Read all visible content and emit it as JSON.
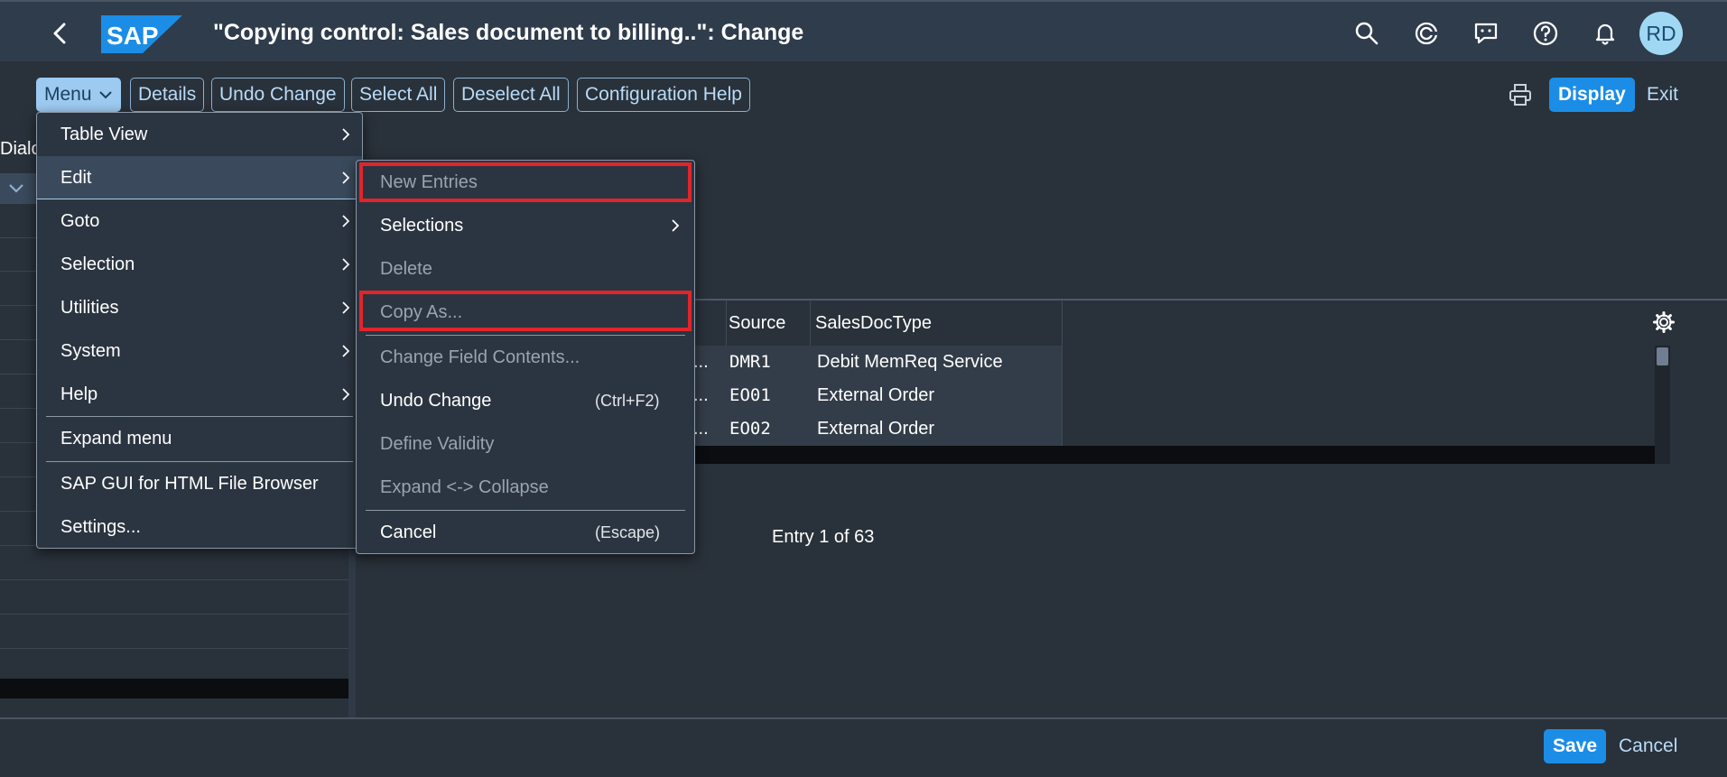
{
  "shell": {
    "logo_text": "SAP",
    "title": "\"Copying control: Sales document to billing..\": Change",
    "avatar_initials": "RD"
  },
  "toolbar": {
    "menu_label": "Menu",
    "details_label": "Details",
    "undo_change_label": "Undo Change",
    "select_all_label": "Select All",
    "deselect_all_label": "Deselect All",
    "config_help_label": "Configuration Help",
    "display_label": "Display",
    "exit_label": "Exit"
  },
  "left_panel": {
    "header": "Dialo"
  },
  "table": {
    "columns": [
      "Source",
      "SalesDocType"
    ],
    "rows": [
      {
        "prefix": "...",
        "source": "DMR1",
        "salesdoctype": "Debit MemReq Service"
      },
      {
        "prefix": "...",
        "source": "EO01",
        "salesdoctype": "External Order"
      },
      {
        "prefix": "...",
        "source": "EO02",
        "salesdoctype": "External Order"
      }
    ],
    "entry_info": "Entry 1 of 63"
  },
  "main_menu": {
    "items": [
      {
        "label": "Table View"
      },
      {
        "label": "Edit"
      },
      {
        "label": "Goto"
      },
      {
        "label": "Selection"
      },
      {
        "label": "Utilities"
      },
      {
        "label": "System"
      },
      {
        "label": "Help"
      },
      {
        "label": "Expand menu"
      },
      {
        "label": "SAP GUI for HTML File Browser"
      },
      {
        "label": "Settings..."
      }
    ]
  },
  "edit_submenu": {
    "items": [
      {
        "label": "New Entries"
      },
      {
        "label": "Selections"
      },
      {
        "label": "Delete"
      },
      {
        "label": "Copy As..."
      },
      {
        "label": "Change Field Contents..."
      },
      {
        "label": "Undo Change",
        "shortcut": "(Ctrl+F2)"
      },
      {
        "label": "Define Validity"
      },
      {
        "label": "Expand <-> Collapse"
      },
      {
        "label": "Cancel",
        "shortcut": "(Escape)"
      }
    ]
  },
  "footer": {
    "save_label": "Save",
    "cancel_label": "Cancel"
  },
  "colors": {
    "shell_bg": "#2f3c4c",
    "page_bg": "#29313a",
    "accent": "#1b8de6",
    "highlight": "#e0252b"
  }
}
